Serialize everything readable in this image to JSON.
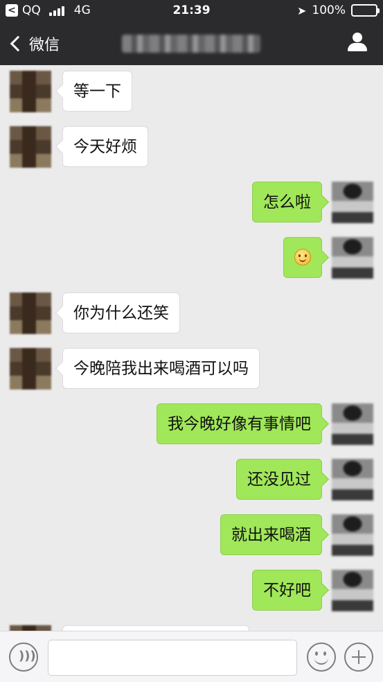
{
  "status_bar": {
    "carrier": "QQ",
    "network": "4G",
    "time": "21:39",
    "battery_percent": "100%",
    "battery_level": 1.0
  },
  "nav": {
    "back_label": "微信",
    "title_obscured": true
  },
  "messages": [
    {
      "side": "in",
      "text": "等一下"
    },
    {
      "side": "in",
      "text": "今天好烦"
    },
    {
      "side": "out",
      "text": "怎么啦"
    },
    {
      "side": "out",
      "emoji": "smiley-icon"
    },
    {
      "side": "in",
      "text": "你为什么还笑"
    },
    {
      "side": "in",
      "text": "今晚陪我出来喝酒可以吗"
    },
    {
      "side": "out",
      "text": "我今晚好像有事情吧"
    },
    {
      "side": "out",
      "text": "还没见过"
    },
    {
      "side": "out",
      "text": "就出来喝酒"
    },
    {
      "side": "out",
      "text": "不好吧"
    },
    {
      "side": "in",
      "text": ""
    }
  ],
  "colors": {
    "nav_bg": "#2b2b2d",
    "chat_bg": "#ebebeb",
    "outgoing_bubble": "#a0e759",
    "incoming_bubble": "#ffffff",
    "battery": "#4cd964"
  },
  "input_bar": {
    "text_value": ""
  }
}
